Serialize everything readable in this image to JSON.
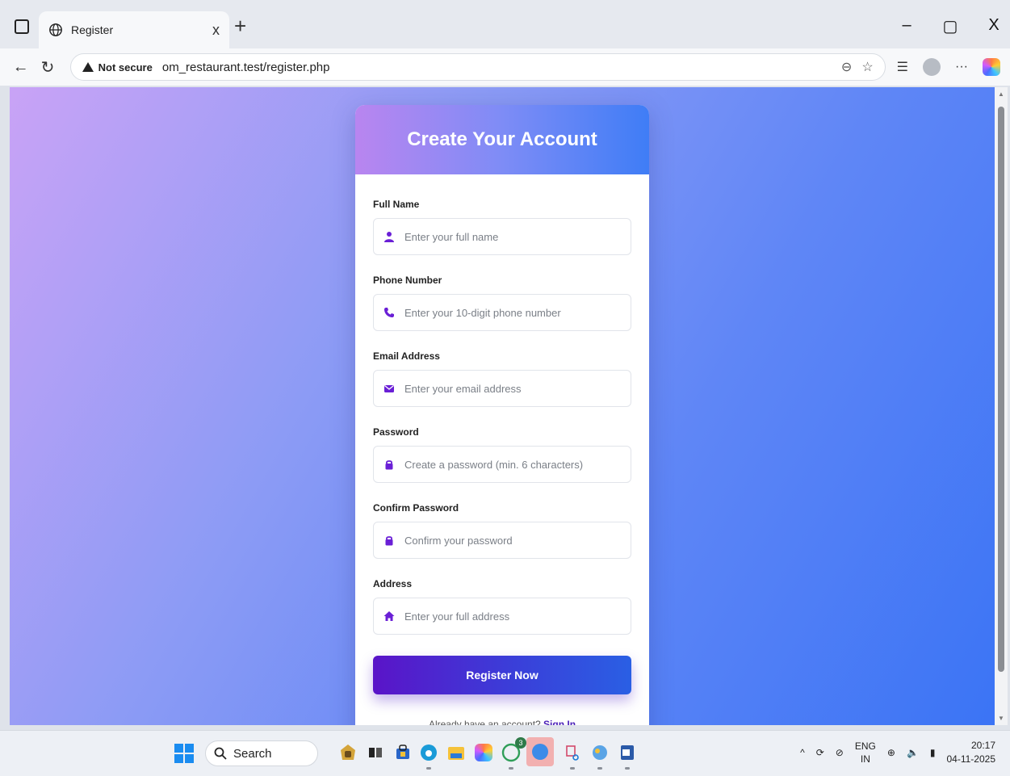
{
  "browser": {
    "tab_title": "Register",
    "tab_close": "x",
    "new_tab": "+",
    "security_label": "Not secure",
    "url": "om_restaurant.test/register.php",
    "window_controls": {
      "minimize": "–",
      "restore": "▢",
      "close": "X"
    }
  },
  "form": {
    "title": "Create Your Account",
    "fields": [
      {
        "label": "Full Name",
        "placeholder": "Enter your full name",
        "icon": "user-icon"
      },
      {
        "label": "Phone Number",
        "placeholder": "Enter your 10-digit phone number",
        "icon": "phone-icon"
      },
      {
        "label": "Email Address",
        "placeholder": "Enter your email address",
        "icon": "envelope-icon"
      },
      {
        "label": "Password",
        "placeholder": "Create a password (min. 6 characters)",
        "icon": "lock-icon"
      },
      {
        "label": "Confirm Password",
        "placeholder": "Confirm your password",
        "icon": "lock-icon"
      },
      {
        "label": "Address",
        "placeholder": "Enter your full address",
        "icon": "home-icon"
      }
    ],
    "submit_label": "Register Now",
    "signin_prompt": "Already have an account?",
    "signin_link": "Sign In"
  },
  "taskbar": {
    "search_label": "Search",
    "whatsapp_badge": "3",
    "lang_top": "ENG",
    "lang_bottom": "IN",
    "time": "20:17",
    "date": "04-11-2025"
  },
  "colors": {
    "accent_purple": "#6a1fd6",
    "accent_blue": "#3b74f5",
    "icon_purple": "#6a1fd6"
  }
}
